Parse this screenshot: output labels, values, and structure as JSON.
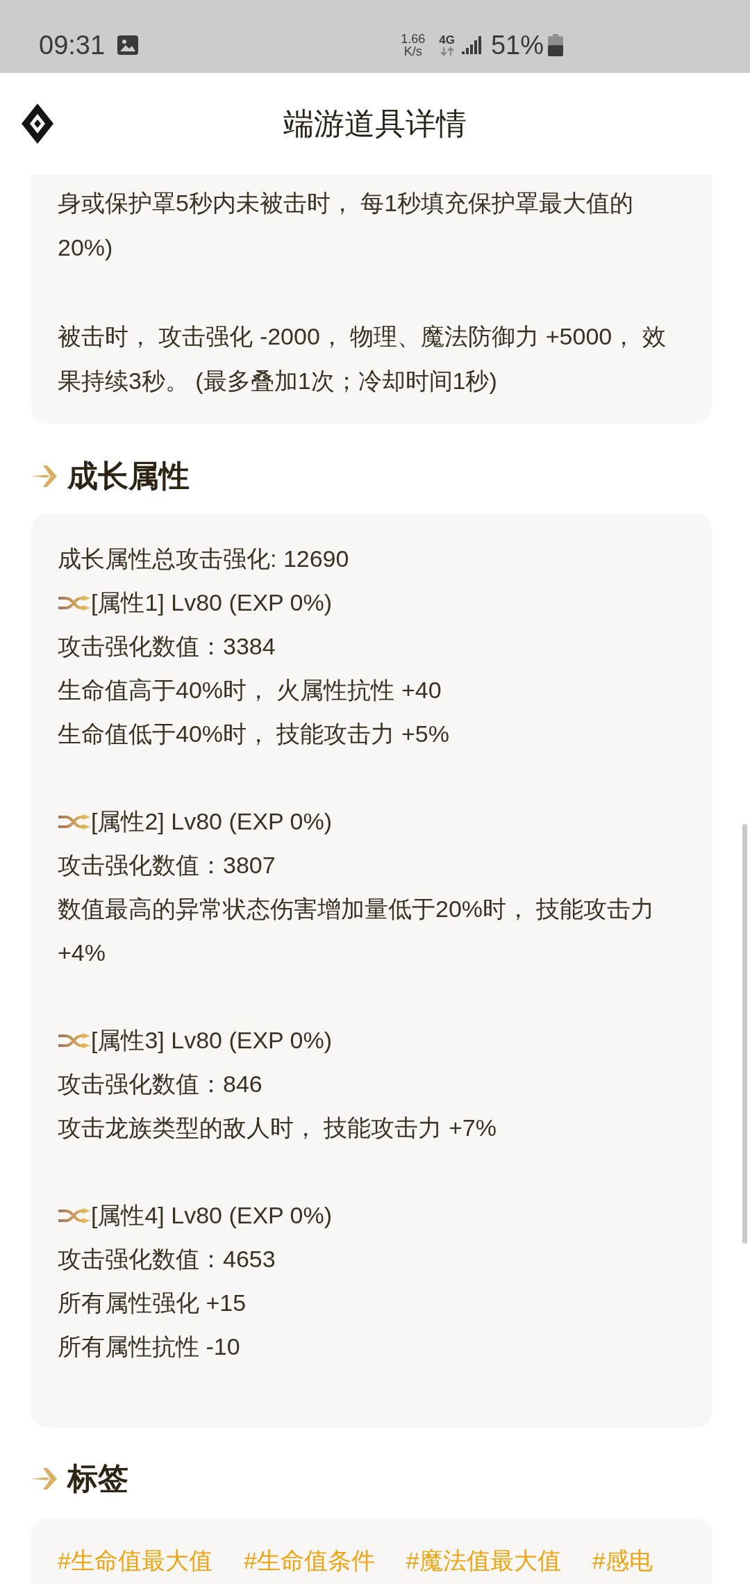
{
  "status_bar": {
    "time": "09:31",
    "net_speed": "1.66",
    "net_speed_unit": "K/s",
    "network": "4G",
    "battery": "51%"
  },
  "header": {
    "title": "端游道具详情"
  },
  "effect_card": {
    "paragraphs": [
      "身或保护罩5秒内未被击时， 每1秒填充保护罩最大值的20%)",
      "被击时， 攻击强化 -2000， 物理、魔法防御力 +5000， 效果持续3秒。 (最多叠加1次；冷却时间1秒)"
    ]
  },
  "growth_section": {
    "title": "成长属性",
    "total": "成长属性总攻击强化: 12690",
    "attributes": [
      {
        "title": "[属性1] Lv80 (EXP 0%)",
        "lines": [
          "攻击强化数值：3384",
          "生命值高于40%时， 火属性抗性 +40",
          "生命值低于40%时， 技能攻击力 +5%"
        ]
      },
      {
        "title": "[属性2] Lv80 (EXP 0%)",
        "lines": [
          "攻击强化数值：3807",
          "数值最高的异常状态伤害增加量低于20%时， 技能攻击力 +4%"
        ]
      },
      {
        "title": "[属性3] Lv80 (EXP 0%)",
        "lines": [
          "攻击强化数值：846",
          "攻击龙族类型的敌人时， 技能攻击力 +7%"
        ]
      },
      {
        "title": "[属性4] Lv80 (EXP 0%)",
        "lines": [
          "攻击强化数值：4653",
          "所有属性强化 +15",
          "所有属性抗性 -10"
        ]
      }
    ]
  },
  "tags_section": {
    "title": "标签",
    "tags": [
      "#生命值最大值",
      "#生命值条件",
      "#魔法值最大值",
      "#感电"
    ]
  }
}
